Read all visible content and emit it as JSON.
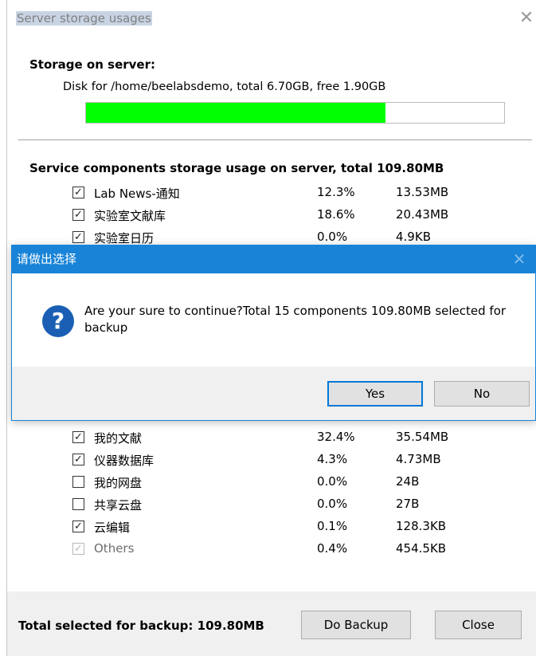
{
  "window": {
    "title": "Server storage usages",
    "close_glyph": "✕"
  },
  "storage": {
    "heading": "Storage on server:",
    "disk_text": "Disk for /home/beelabsdemo, total 6.70GB, free 1.90GB",
    "used_fraction": 0.716,
    "bar_color": "#00ff00"
  },
  "services": {
    "heading": "Service components storage usage on server, total 109.80MB",
    "rows_top": [
      {
        "name": "Lab News-通知",
        "checked": true,
        "percent": "12.3%",
        "size": "13.53MB"
      },
      {
        "name": "实验室文献库",
        "checked": true,
        "percent": "18.6%",
        "size": "20.43MB"
      },
      {
        "name": "实验室日历",
        "checked": true,
        "percent": "0.0%",
        "size": "4.9KB"
      }
    ],
    "rows_bottom": [
      {
        "name": "我的文献",
        "checked": true,
        "percent": "32.4%",
        "size": "35.54MB"
      },
      {
        "name": "仪器数据库",
        "checked": true,
        "percent": "4.3%",
        "size": "4.73MB"
      },
      {
        "name": "我的网盘",
        "checked": false,
        "percent": "0.0%",
        "size": "24B"
      },
      {
        "name": "共享云盘",
        "checked": false,
        "percent": "0.0%",
        "size": "27B"
      },
      {
        "name": "云编辑",
        "checked": true,
        "percent": "0.1%",
        "size": "128.3KB"
      },
      {
        "name": "Others",
        "checked": true,
        "disabled": true,
        "percent": "0.4%",
        "size": "454.5KB"
      }
    ]
  },
  "footer": {
    "total_text": "Total selected for backup: 109.80MB",
    "backup_label": "Do Backup",
    "close_label": "Close"
  },
  "dialog": {
    "title": "请做出选择",
    "close_glyph": "✕",
    "icon": "question-icon",
    "message": "Are your sure to continue?Total 15 components 109.80MB selected for backup",
    "yes_label": "Yes",
    "no_label": "No",
    "accent": "#1883d7"
  }
}
